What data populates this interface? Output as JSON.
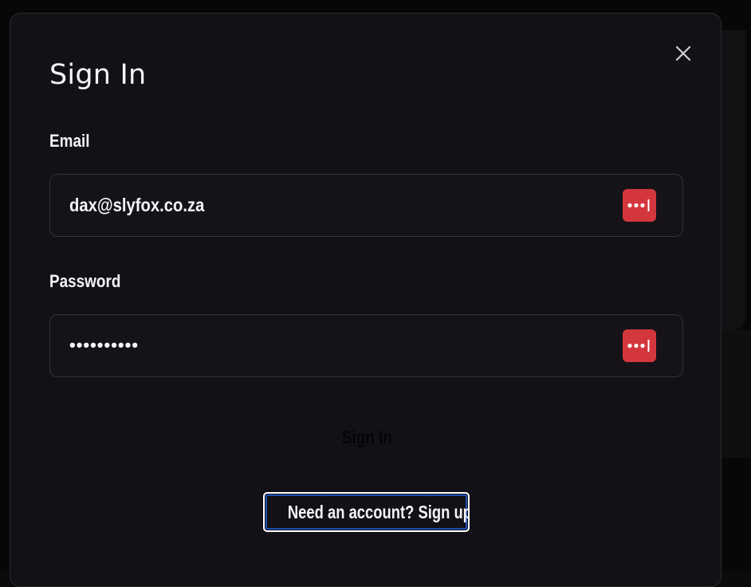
{
  "dialog": {
    "title": "Sign In",
    "close_icon": "close-icon"
  },
  "email": {
    "label": "Email",
    "value": "dax@slyfox.co.za",
    "password_manager_icon": "password-manager-icon"
  },
  "password": {
    "label": "Password",
    "value": "••••••••••",
    "password_manager_icon": "password-manager-icon"
  },
  "actions": {
    "submit_label": "Sign In",
    "signup_link": "Need an account? Sign up"
  },
  "colors": {
    "modal_bg": "#131116",
    "field_border": "#34313a",
    "password_manager_red": "#d3373d",
    "focus_ring": "#1e50b4"
  }
}
